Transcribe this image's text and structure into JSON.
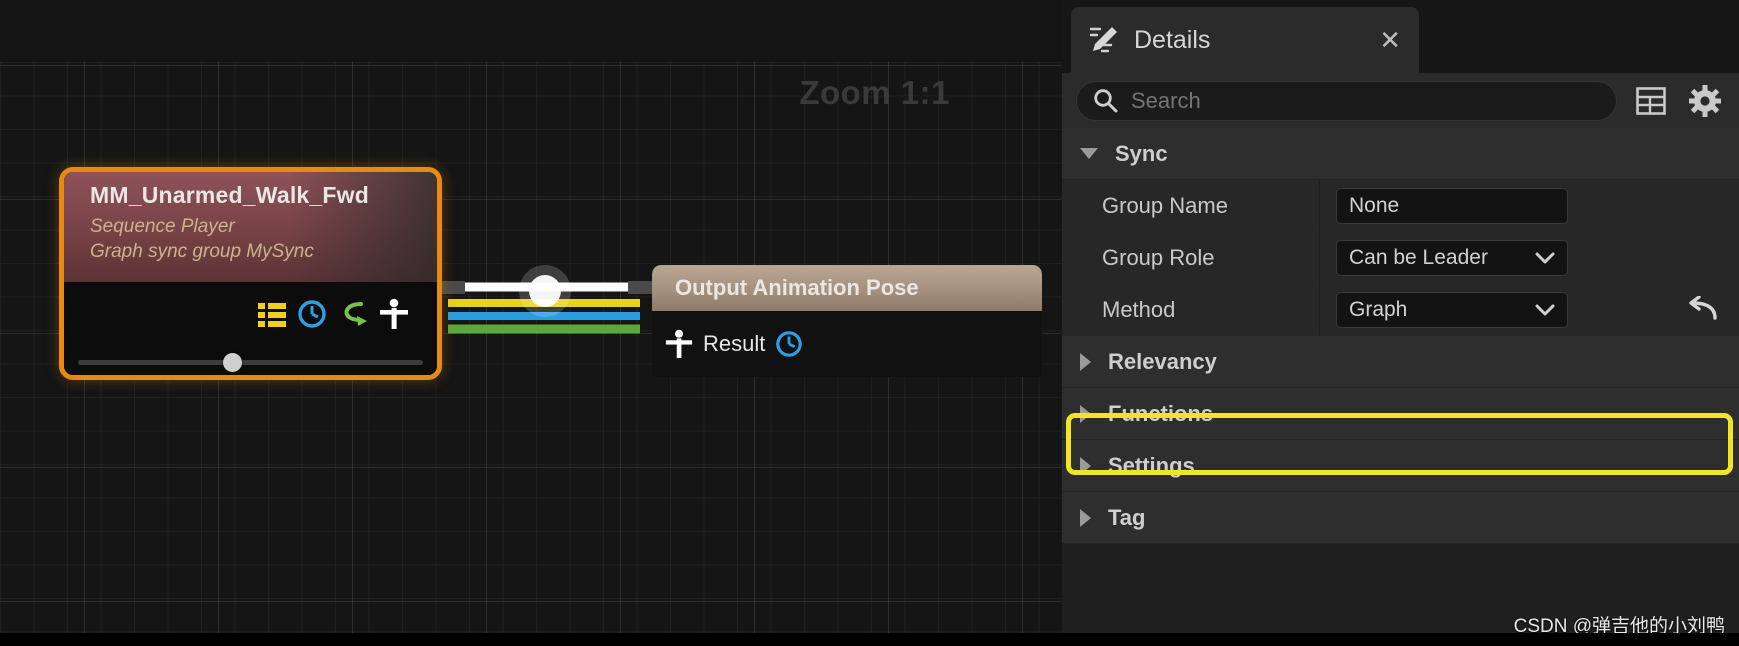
{
  "graph": {
    "zoom_label": "Zoom 1:1",
    "sequence_node": {
      "title": "MM_Unarmed_Walk_Fwd",
      "subtitle_1": "Sequence Player",
      "subtitle_2": "Graph sync group MySync",
      "icons": [
        "list-icon",
        "clock-icon",
        "loop-arrow-icon",
        "pose-person-icon"
      ],
      "slider_value_percent": 42
    },
    "output_node": {
      "title": "Output Animation Pose",
      "result_label": "Result",
      "result_icons": [
        "pose-person-icon",
        "clock-icon"
      ]
    },
    "wire_colors": [
      "#ffffff",
      "#e8d21a",
      "#2a9ce0",
      "#5ca83a"
    ]
  },
  "details": {
    "tab": {
      "label": "Details",
      "icon": "details-pencil-icon",
      "close_label": "✕"
    },
    "search": {
      "placeholder": "Search",
      "icon": "search-icon"
    },
    "toolbar": [
      {
        "name": "column-view-icon",
        "label": ""
      },
      {
        "name": "settings-gear-icon",
        "label": ""
      }
    ],
    "categories": [
      {
        "label": "Sync",
        "expanded": true
      },
      {
        "label": "Relevancy",
        "expanded": false
      },
      {
        "label": "Functions",
        "expanded": false
      },
      {
        "label": "Settings",
        "expanded": false
      },
      {
        "label": "Tag",
        "expanded": false
      }
    ],
    "sync_properties": [
      {
        "name": "Group Name",
        "value": "None",
        "has_dropdown": false,
        "has_reset": false,
        "highlighted": false
      },
      {
        "name": "Group Role",
        "value": "Can be Leader",
        "has_dropdown": true,
        "has_reset": false,
        "highlighted": false
      },
      {
        "name": "Method",
        "value": "Graph",
        "has_dropdown": true,
        "has_reset": true,
        "highlighted": true
      }
    ],
    "highlight_color": "#f4e426"
  },
  "watermark": {
    "text": "CSDN @弹吉他的小刘鸭"
  }
}
